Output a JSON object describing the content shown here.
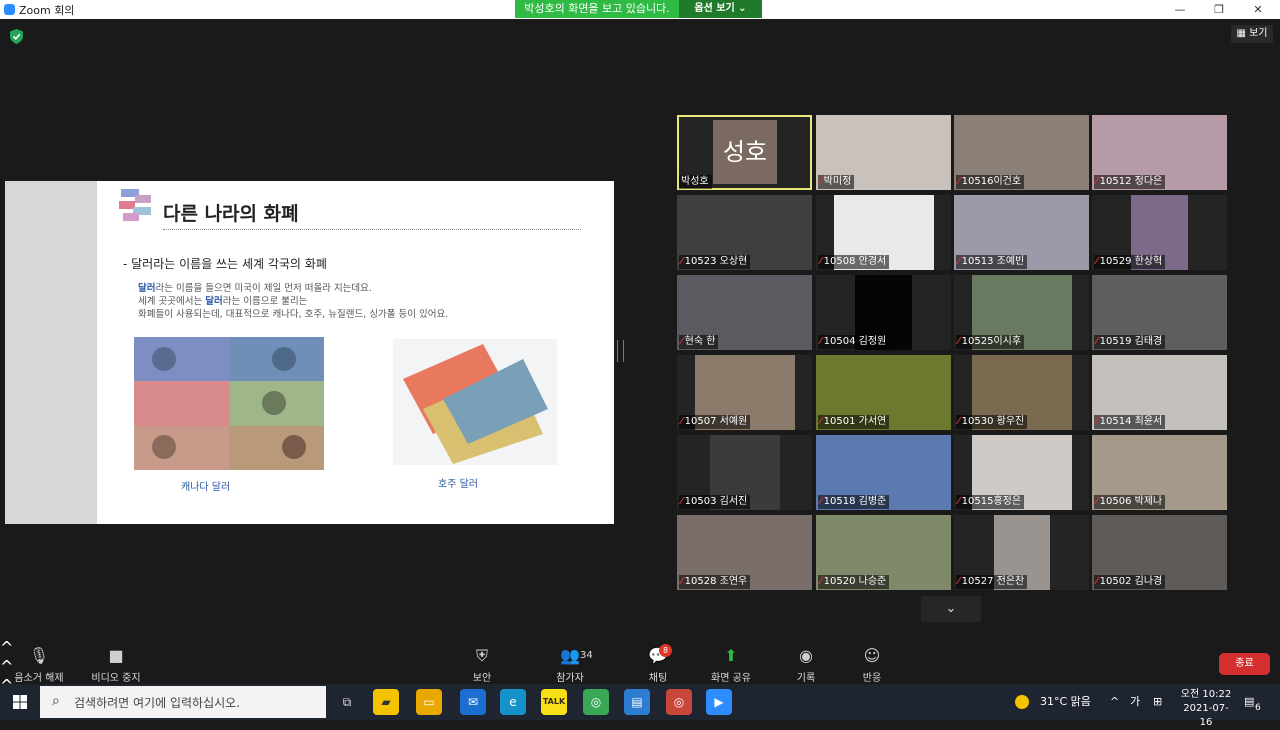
{
  "window": {
    "title": "Zoom 회의",
    "share_banner": "박성호의 화면을 보고 있습니다.",
    "view_options": "옵션 보기 ⌄",
    "minimize": "—",
    "restore": "❐",
    "close": "✕"
  },
  "meeting": {
    "view_button": "보기",
    "more_participants": "⌄"
  },
  "slide": {
    "title": "다른 나라의 화폐",
    "bullet": "-  달러라는 이름을 쓰는 세계 각국의 화폐",
    "body_line1_hl": "달러",
    "body_line1_rest": "라는 이름을 들으면 미국이 제일 먼저 떠올라 지는데요.",
    "body_line2_a": "세계 곳곳에서는 ",
    "body_line2_hl": "달러",
    "body_line2_b": "라는 이름으로 불리는",
    "body_line3": "화폐들이 사용되는데, 대표적으로 캐나다, 호주, 뉴질랜드, 싱가폴 등이 있어요.",
    "caption_canada": "캐나다 달러",
    "caption_australia": "호주 달러"
  },
  "participants": [
    {
      "name": "박성호",
      "muted": false,
      "avatar_text": "성호",
      "active": true
    },
    {
      "name": "박미정",
      "muted": true
    },
    {
      "name": "10516이건호",
      "muted": true
    },
    {
      "name": "10512 정다은",
      "muted": true
    },
    {
      "name": "10523 오상현",
      "muted": true
    },
    {
      "name": "10508 안경서",
      "muted": true
    },
    {
      "name": "10513 조예빈",
      "muted": true
    },
    {
      "name": "10529 한상혁",
      "muted": true
    },
    {
      "name": "현숙 한",
      "muted": true
    },
    {
      "name": "10504 김정원",
      "muted": true
    },
    {
      "name": "10525이시후",
      "muted": true
    },
    {
      "name": "10519 김태경",
      "muted": true
    },
    {
      "name": "10507 서예원",
      "muted": true
    },
    {
      "name": "10501 가서연",
      "muted": true
    },
    {
      "name": "10530 황우진",
      "muted": true
    },
    {
      "name": "10514 최윤서",
      "muted": true
    },
    {
      "name": "10503 김서진",
      "muted": true
    },
    {
      "name": "10518 김병준",
      "muted": true
    },
    {
      "name": "10515홍정은",
      "muted": true
    },
    {
      "name": "10506 박제나",
      "muted": true
    },
    {
      "name": "10528 조연우",
      "muted": true
    },
    {
      "name": "10520 나승준",
      "muted": true
    },
    {
      "name": "10527 전은찬",
      "muted": true
    },
    {
      "name": "10502 김나경",
      "muted": true
    }
  ],
  "controls": {
    "unmute": "음소거 해제",
    "stop_video": "비디오 중지",
    "security": "보안",
    "participants": "참가자",
    "participants_count": "34",
    "chat": "채팅",
    "chat_badge": "8",
    "share_screen": "화면 공유",
    "record": "기록",
    "reactions": "반응",
    "end": "종료"
  },
  "taskbar": {
    "search_placeholder": "검색하려면 여기에 입력하십시오.",
    "temperature": "31°C  맑음",
    "ime": "가",
    "time": "오전 10:22",
    "date": "2021-07-16",
    "notification_count": "6"
  },
  "colors": {
    "share_green": "#2fba44",
    "end_red": "#d32f2f",
    "active_border": "#e8e67a",
    "zoom_blue": "#2d8cff"
  }
}
